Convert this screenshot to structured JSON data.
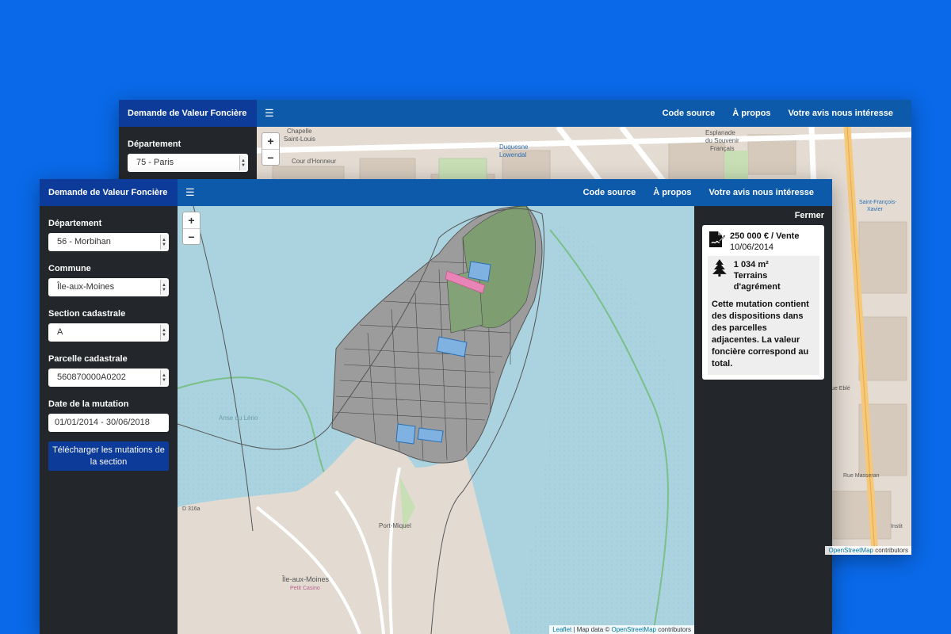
{
  "back_window": {
    "brand": "Demande de Valeur Foncière",
    "menu_icon": "hamburger-icon",
    "nav": [
      "Code source",
      "À propos",
      "Votre avis nous intéresse"
    ],
    "sidebar": {
      "departement_label": "Département",
      "departement_value": "75 - Paris"
    },
    "zoom": {
      "in": "+",
      "out": "−"
    },
    "map_labels": {
      "chapelle": "Chapelle",
      "saint_louis": "Saint-Louis",
      "cour": "Cour d'Honneur",
      "duquesne": "Duquesne",
      "lowendal": "Lowendal",
      "esplanade": "Esplanade",
      "souvenir": "du Souvenir",
      "francais": "Français",
      "francois": "Saint-François-",
      "xavier": "Xavier",
      "rue_eble": "Rue Eblé",
      "rue_masseran": "Rue Masseran",
      "institut": "Instit"
    },
    "attribution": {
      "link": "OpenStreetMap",
      "suffix": "contributors"
    }
  },
  "front_window": {
    "brand": "Demande de Valeur Foncière",
    "menu_icon": "hamburger-icon",
    "nav": [
      "Code source",
      "À propos",
      "Votre avis nous intéresse"
    ],
    "sidebar": {
      "departement_label": "Département",
      "departement_value": "56 - Morbihan",
      "commune_label": "Commune",
      "commune_value": "Île-aux-Moines",
      "section_label": "Section cadastrale",
      "section_value": "A",
      "parcelle_label": "Parcelle cadastrale",
      "parcelle_value": "560870000A0202",
      "date_label": "Date de la mutation",
      "date_value": "01/01/2014 - 30/06/2018",
      "download_button": "Télécharger les mutations de la section"
    },
    "zoom": {
      "in": "+",
      "out": "−"
    },
    "map_labels": {
      "anse": "Anse du Lério",
      "port_miquel": "Port-Miquel",
      "ile_aux_moines": "Île-aux-Moines",
      "petit_casino": "Petit Casino",
      "road": "D 316a"
    },
    "attribution": {
      "leaflet": "Leaflet",
      "mid": " | Map data © ",
      "osm": "OpenStreetMap",
      "suffix": " contributors"
    },
    "info_panel": {
      "close": "Fermer",
      "price": "250 000 € / Vente",
      "date": "10/06/2014",
      "surface": "1 034 m²",
      "nature": "Terrains d'agrément",
      "note": "Cette mutation contient des dispositions dans des parcelles adjacentes. La valeur foncière correspond au total.",
      "sale_icon": "signature-document-icon",
      "nature_icon": "tree-icon"
    }
  },
  "colors": {
    "background": "#0a69e8",
    "navbar": "#0c5aa9",
    "brand": "#0d3b99",
    "sidebar": "#23272b",
    "water": "#aad3df",
    "parcel": "#9c9c9c",
    "highlight": "#e984b7",
    "selected": "#7fb2e0"
  }
}
